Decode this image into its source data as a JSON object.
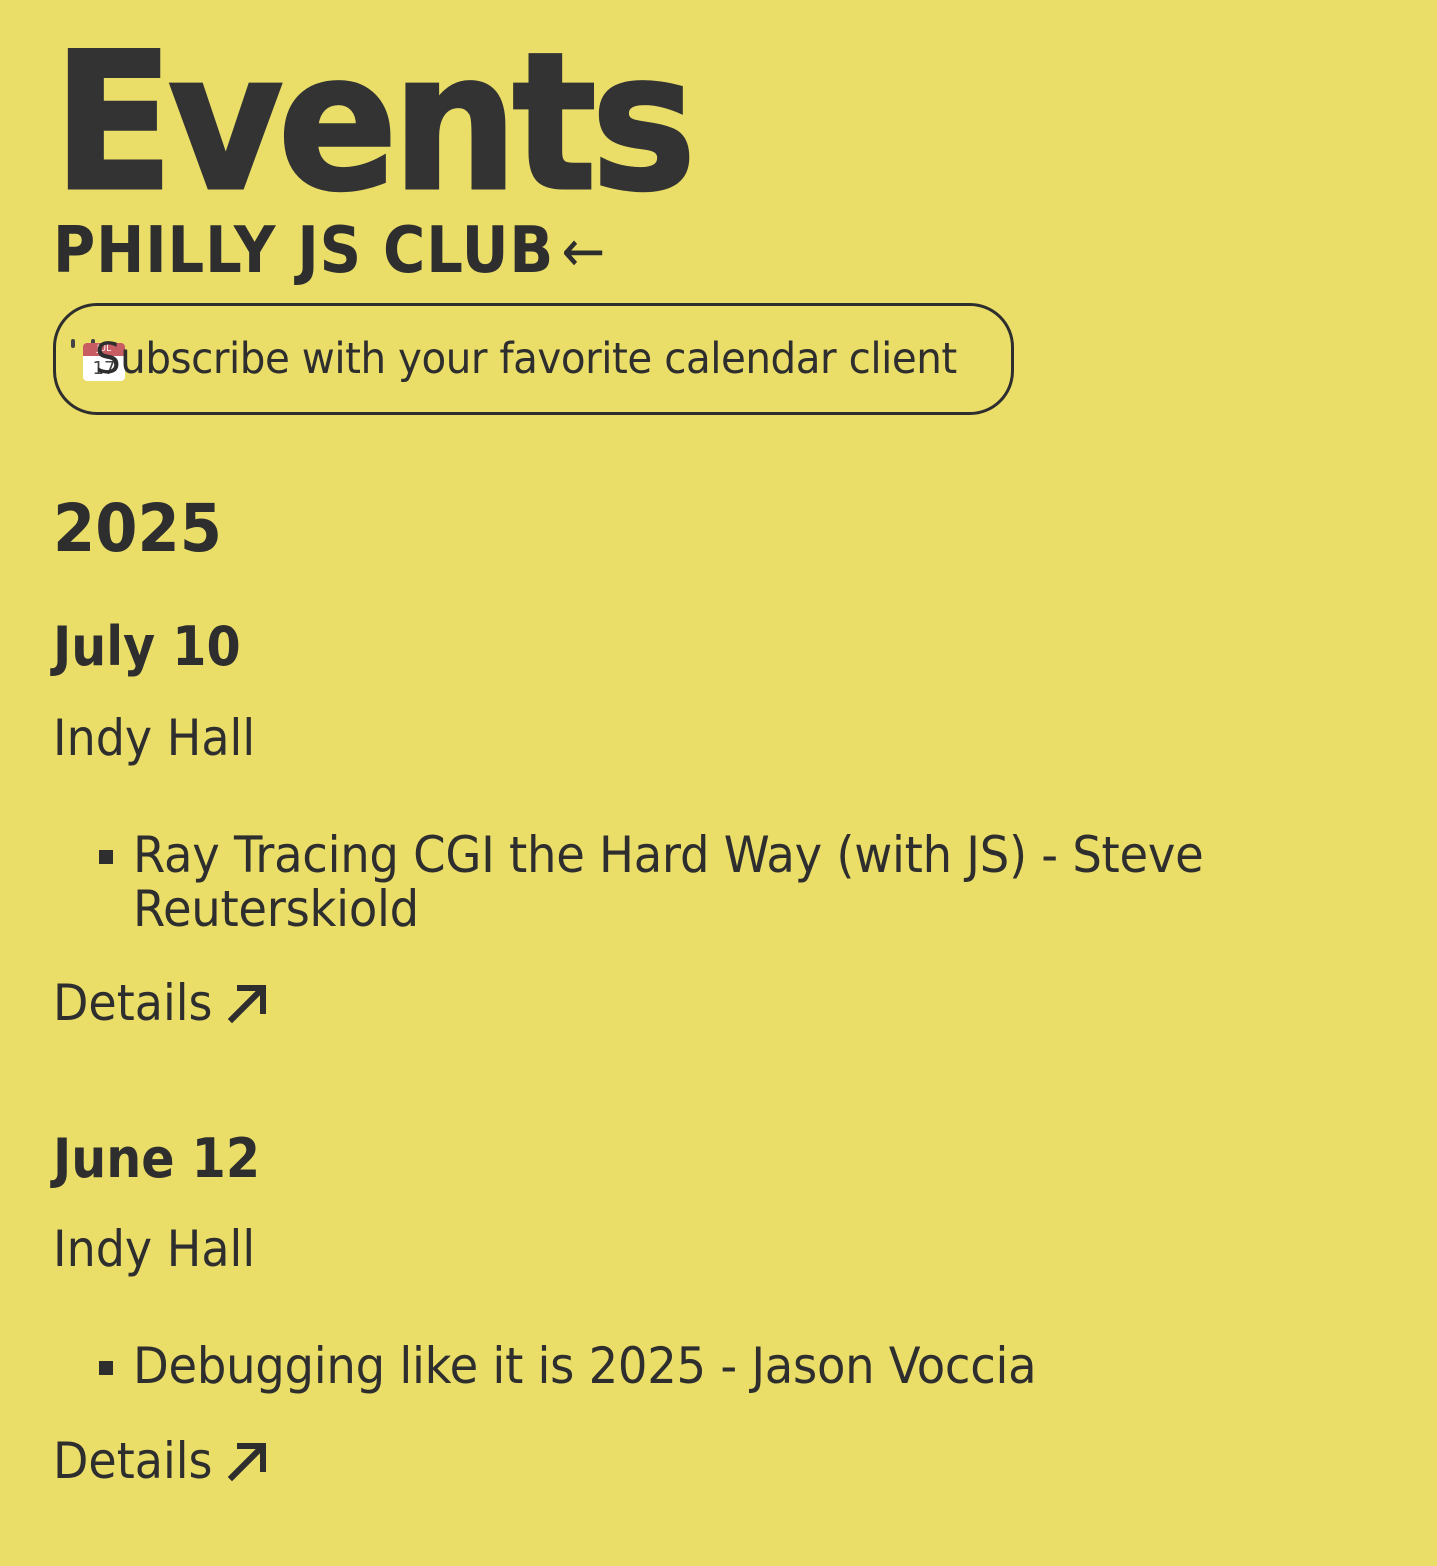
{
  "header": {
    "title": "Events",
    "club_link_label": "PHILLY JS CLUB",
    "club_link_arrow": "←"
  },
  "subscribe": {
    "icon": "calendar-icon",
    "icon_month": "JUL",
    "icon_day": "17",
    "label": "Subscribe with your favorite calendar client"
  },
  "year_heading": "2025",
  "events": [
    {
      "date": "July 10",
      "venue": "Indy Hall",
      "talks": [
        "Ray Tracing CGI the Hard Way (with JS) - Steve Reuterskiold"
      ],
      "details_label": "Details",
      "details_icon": "arrow-up-right-icon"
    },
    {
      "date": "June 12",
      "venue": "Indy Hall",
      "talks": [
        "Debugging like it is 2025 - Jason Voccia"
      ],
      "details_label": "Details",
      "details_icon": "arrow-up-right-icon"
    }
  ],
  "colors": {
    "background": "#EADE69",
    "text": "#2E2E2E"
  }
}
